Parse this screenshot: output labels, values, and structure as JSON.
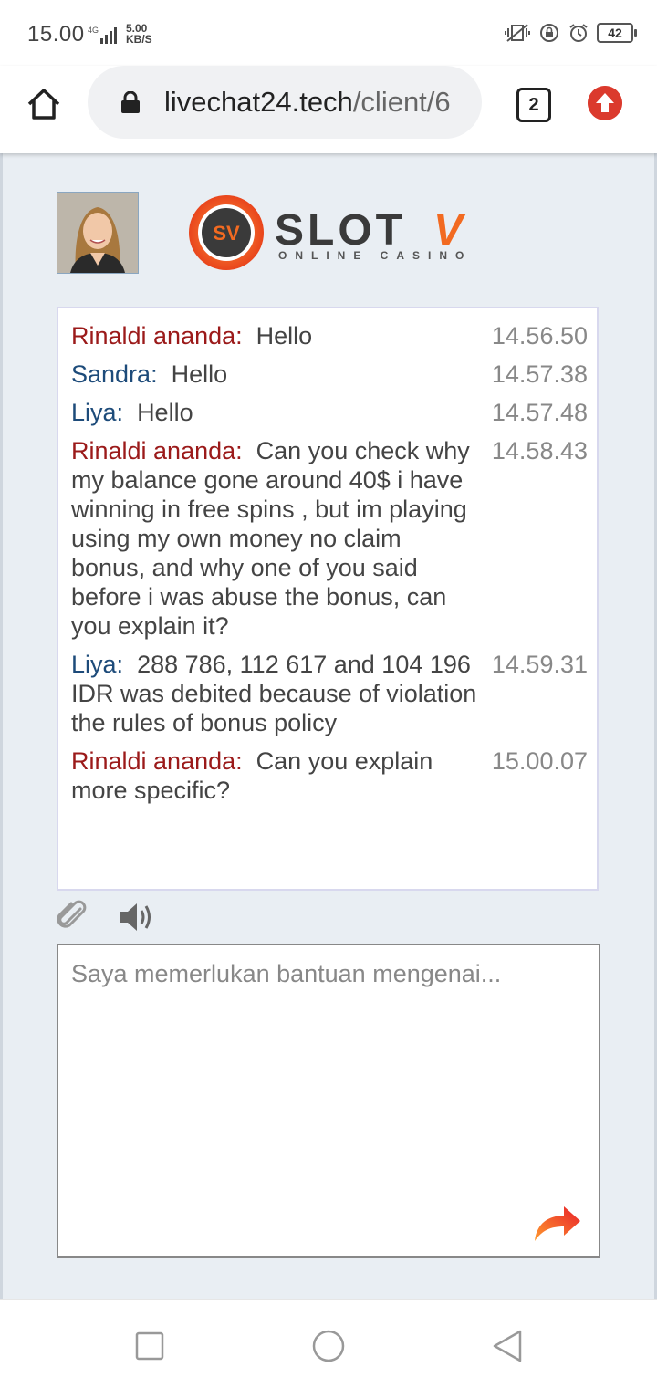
{
  "status_bar": {
    "time": "15.00",
    "network": "4G",
    "speed_value": "5.00",
    "speed_unit": "KB/S",
    "battery": "42"
  },
  "browser": {
    "url_domain": "livechat24.tech",
    "url_path": "/client/6",
    "tab_count": "2"
  },
  "chat": {
    "messages": [
      {
        "sender": "Rinaldi ananda:",
        "role": "user",
        "text": "Hello",
        "time": "14.56.50"
      },
      {
        "sender": "Sandra:",
        "role": "agent",
        "text": "Hello",
        "time": "14.57.38"
      },
      {
        "sender": "Liya:",
        "role": "agent",
        "text": "Hello",
        "time": "14.57.48"
      },
      {
        "sender": "Rinaldi ananda:",
        "role": "user",
        "text": "Can you check why my balance gone around 40$ i have winning in free spins , but im playing using my own money no claim bonus, and why one of you said before i was abuse the bonus, can you explain it?",
        "time": "14.58.43"
      },
      {
        "sender": "Liya:",
        "role": "agent",
        "text": "288 786, 112 617 and 104 196 IDR was debited because of violation the rules of bonus policy",
        "time": "14.59.31"
      },
      {
        "sender": "Rinaldi ananda:",
        "role": "user",
        "text": "Can you explain more specific?",
        "time": "15.00.07"
      }
    ]
  },
  "composer": {
    "placeholder": "Saya memerlukan bantuan mengenai..."
  },
  "logo": {
    "badge": "SV",
    "brand": "SLOT",
    "brand_accent": "V",
    "tagline": "ONLINE CASINO"
  },
  "colors": {
    "user_name": "#9b1a1a",
    "agent_name": "#1d4b7a",
    "page_bg": "#e9eef3",
    "logo_orange": "#f26a21"
  }
}
